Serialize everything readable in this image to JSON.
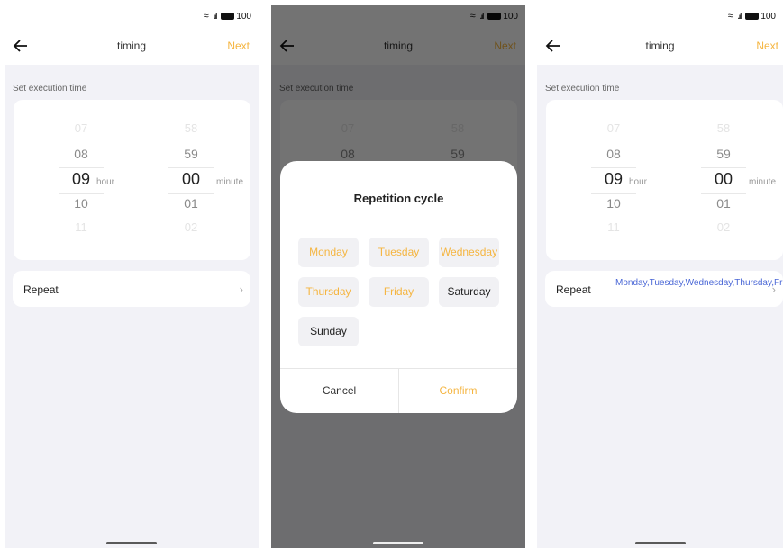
{
  "status": {
    "battery": "100"
  },
  "nav": {
    "title": "timing",
    "next": "Next"
  },
  "section_label": "Set execution time",
  "picker": {
    "hours": [
      "07",
      "08",
      "09",
      "10",
      "11"
    ],
    "minutes": [
      "58",
      "59",
      "00",
      "01",
      "02"
    ],
    "hour_unit": "hour",
    "minute_unit": "minute"
  },
  "repeat": {
    "label": "Repeat",
    "value": "Monday,Tuesday,Wednesday,Thursday,Friday"
  },
  "dialog": {
    "title": "Repetition cycle",
    "days": [
      {
        "label": "Monday",
        "selected": true
      },
      {
        "label": "Tuesday",
        "selected": true
      },
      {
        "label": "Wednesday",
        "selected": true
      },
      {
        "label": "Thursday",
        "selected": true
      },
      {
        "label": "Friday",
        "selected": true
      },
      {
        "label": "Saturday",
        "selected": false
      },
      {
        "label": "Sunday",
        "selected": false
      }
    ],
    "cancel": "Cancel",
    "confirm": "Confirm"
  },
  "colors": {
    "accent": "#f5b540",
    "value_blue": "#4a67d6",
    "background": "#f2f2f7"
  }
}
